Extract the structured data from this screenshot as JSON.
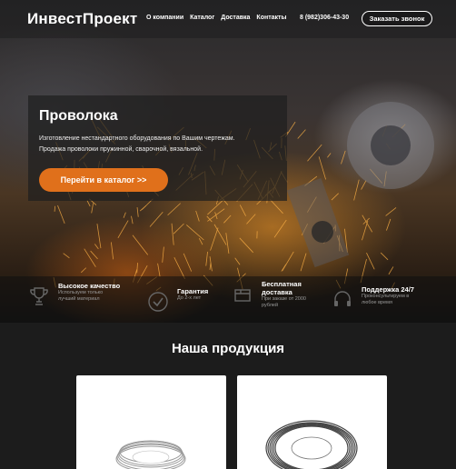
{
  "header": {
    "logo": "ИнвестПроект",
    "nav": [
      "О компании",
      "Каталог",
      "Доставка",
      "Контакты"
    ],
    "phone": "8 (982)306-43-30",
    "call_button": "Заказать звонок"
  },
  "hero": {
    "title": "Проволока",
    "line1": "Изготовление нестандартного оборудования по Вашим чертежам.",
    "line2": "Продажа проволоки пружинной, сварочной, вязальной.",
    "catalog_button": "Перейти в каталог >>"
  },
  "features": [
    {
      "icon": "trophy-icon",
      "title": "Высокое качество",
      "subtitle": [
        "Используем только",
        "лучший материал"
      ]
    },
    {
      "icon": "checkmark-icon",
      "title": "Гарантия",
      "subtitle": [
        "До 2-х лет"
      ]
    },
    {
      "icon": "delivery-box-icon",
      "title": "Бесплатная\nдоставка",
      "subtitle": [
        "При заказе от 2000",
        "рублей"
      ]
    },
    {
      "icon": "headset-icon",
      "title": "Поддержка 24/7",
      "subtitle": [
        "Проконсультируем в",
        "любое время"
      ]
    }
  ],
  "products": {
    "title": "Наша продукция",
    "items": [
      {
        "image": "wire-coil-light"
      },
      {
        "image": "wire-coil-dark"
      }
    ]
  },
  "colors": {
    "accent": "#e0701b",
    "background": "#1c1c1c"
  }
}
